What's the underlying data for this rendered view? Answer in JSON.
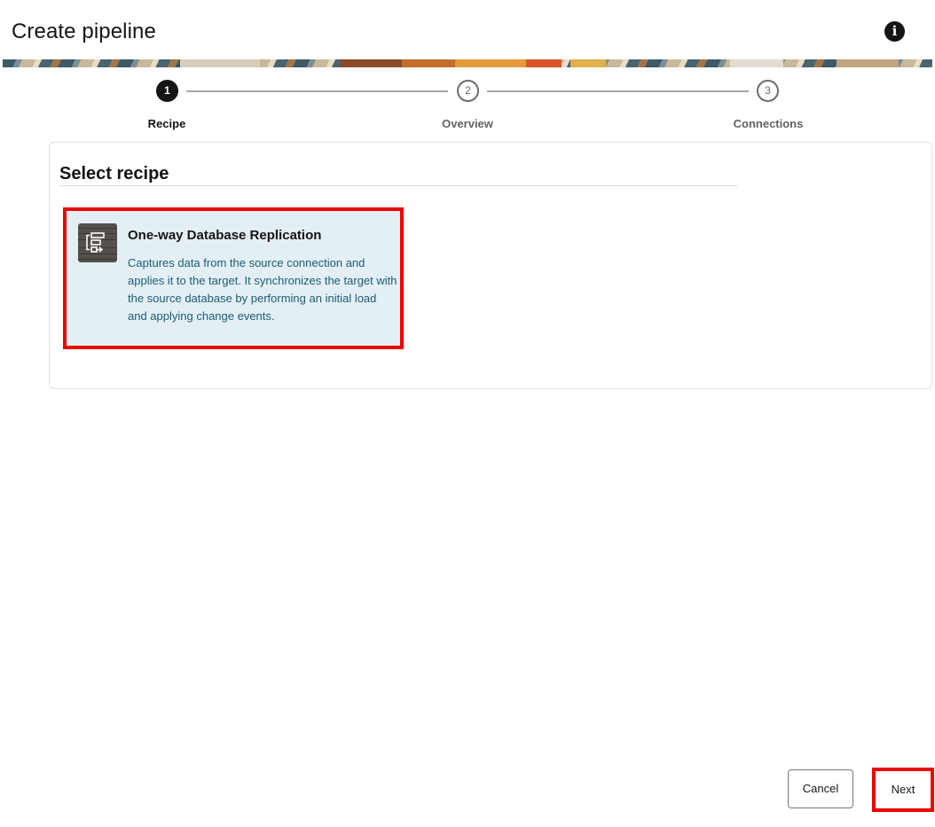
{
  "header": {
    "title": "Create pipeline",
    "info_icon": "info-icon",
    "info_glyph": "i"
  },
  "stepper": {
    "steps": [
      {
        "number": "1",
        "label": "Recipe",
        "state": "active"
      },
      {
        "number": "2",
        "label": "Overview",
        "state": "todo"
      },
      {
        "number": "3",
        "label": "Connections",
        "state": "todo"
      }
    ]
  },
  "panel": {
    "title": "Select recipe",
    "recipe": {
      "icon": "database-replication-icon",
      "name": "One-way Database Replication",
      "description": "Captures data from the source connection and applies it to the target. It synchronizes the target with the source database by performing an initial load and applying change events.",
      "selected": true
    }
  },
  "footer": {
    "cancel_label": "Cancel",
    "next_label": "Next"
  },
  "colors": {
    "highlight": "#ee0000",
    "card_bg": "#e3eff5",
    "description_text": "#1c5c78",
    "active_step": "#161513"
  }
}
